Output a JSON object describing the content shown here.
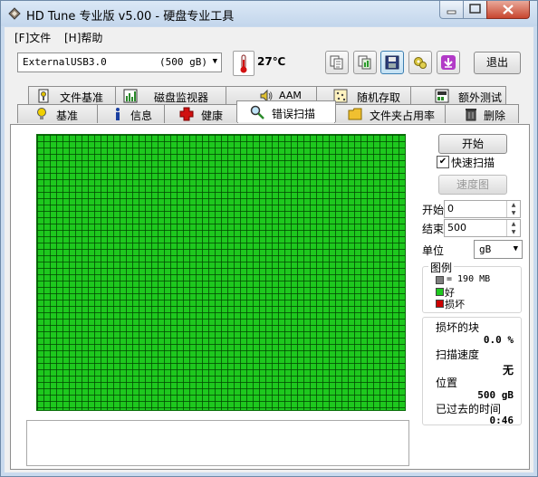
{
  "window": {
    "title": "HD Tune 专业版 v5.00 - 硬盘专业工具"
  },
  "menu": {
    "file": "[F]文件",
    "help": "[H]帮助"
  },
  "toolbar": {
    "drive_name": "ExternalUSB3.0",
    "drive_size": "(500 gB)",
    "temperature": "27℃",
    "exit_label": "退出",
    "buttons": [
      "copy-text-icon",
      "copy-screenshot-icon",
      "save-icon",
      "options-icon",
      "download-icon"
    ]
  },
  "tabs": {
    "top": [
      "文件基准",
      "磁盘监视器",
      "AAM",
      "随机存取",
      "额外测试"
    ],
    "bottom": [
      "基准",
      "信息",
      "健康",
      "错误扫描",
      "文件夹占用率",
      "删除"
    ],
    "selected": "错误扫描"
  },
  "scan": {
    "start_button": "开始",
    "quick_scan_label": "快速扫描",
    "quick_scan_checked": true,
    "speed_map_button": "速度图",
    "start_label": "开始",
    "start_value": "0",
    "end_label": "结束",
    "end_value": "500",
    "unit_label": "单位",
    "unit_value": "gB",
    "grid_color": "#1ec81e",
    "block_status": "all good"
  },
  "legend": {
    "title": "图例",
    "block_size": "= 190 MB",
    "good": "好",
    "damaged": "损坏",
    "colors": {
      "block": "#7f7f7f",
      "good": "#1ec81e",
      "damaged": "#cc0000"
    }
  },
  "stats": {
    "damaged_blocks_label": "损坏的块",
    "damaged_blocks_value": "0.0 %",
    "scan_speed_label": "扫描速度",
    "scan_speed_value": "无",
    "position_label": "位置",
    "position_value": "500 gB",
    "elapsed_label": "已过去的时间",
    "elapsed_value": "0:46"
  }
}
